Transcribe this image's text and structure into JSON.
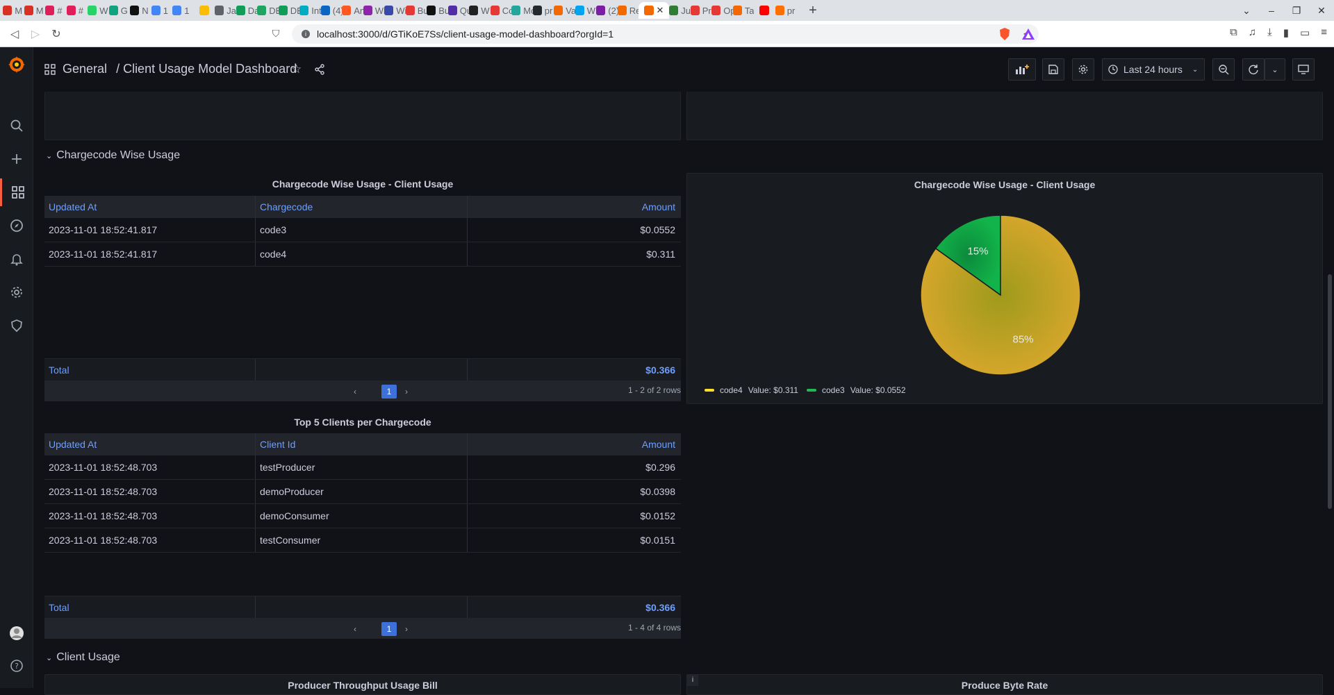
{
  "browser": {
    "tabs": [
      {
        "icon": "gmail-icon",
        "label": "M",
        "color": "#d93025"
      },
      {
        "icon": "gmail-icon",
        "label": "M",
        "color": "#d93025"
      },
      {
        "icon": "slack-icon",
        "label": "#",
        "color": "#e01e5a"
      },
      {
        "icon": "slack-icon",
        "label": "#",
        "color": "#e01e5a"
      },
      {
        "icon": "whatsapp-icon",
        "label": "W",
        "color": "#25d366"
      },
      {
        "icon": "chatgpt-icon",
        "label": "G",
        "color": "#10a37f"
      },
      {
        "icon": "notion-icon",
        "label": "N",
        "color": "#111111"
      },
      {
        "icon": "calendar-icon",
        "label": "1",
        "color": "#4285f4"
      },
      {
        "icon": "calendar-icon",
        "label": "1",
        "color": "#4285f4"
      },
      {
        "icon": "keep-icon",
        "label": "",
        "color": "#fbbc04"
      },
      {
        "icon": "globe-icon",
        "label": "Ja",
        "color": "#5f6368"
      },
      {
        "icon": "sheets-icon",
        "label": "Da",
        "color": "#0f9d58"
      },
      {
        "icon": "drive-icon",
        "label": "DE",
        "color": "#1fa463"
      },
      {
        "icon": "sheets-icon",
        "label": "DE",
        "color": "#0f9d58"
      },
      {
        "icon": "web-icon",
        "label": "Int",
        "color": "#00acc1"
      },
      {
        "icon": "linkedin-icon",
        "label": "(4)",
        "color": "#0a66c2"
      },
      {
        "icon": "aws-icon",
        "label": "An",
        "color": "#ff5722"
      },
      {
        "icon": "web-icon",
        "label": "Wi",
        "color": "#8e24aa"
      },
      {
        "icon": "web-icon",
        "label": "Wi",
        "color": "#3949ab"
      },
      {
        "icon": "web-icon",
        "label": "Bu",
        "color": "#e53935"
      },
      {
        "icon": "web-icon",
        "label": "Bu",
        "color": "#111111"
      },
      {
        "icon": "web-icon",
        "label": "Qu",
        "color": "#512da8"
      },
      {
        "icon": "web-icon",
        "label": "W",
        "color": "#212121"
      },
      {
        "icon": "mic-icon",
        "label": "Cc",
        "color": "#e53935"
      },
      {
        "icon": "web-icon",
        "label": "Mo",
        "color": "#26a69a"
      },
      {
        "icon": "github-icon",
        "label": "pr",
        "color": "#24292e"
      },
      {
        "icon": "grafana-icon",
        "label": "Va",
        "color": "#f46800"
      },
      {
        "icon": "microsoft-icon",
        "label": "W",
        "color": "#00a4ef"
      },
      {
        "icon": "web-icon",
        "label": "(2)",
        "color": "#7b1fa2"
      },
      {
        "icon": "grafana-icon",
        "label": "Re",
        "color": "#f46800"
      },
      {
        "icon": "grafana-icon",
        "label": "",
        "color": "#f46800",
        "active": true
      },
      {
        "icon": "web-icon",
        "label": "Ju",
        "color": "#2e7d32"
      },
      {
        "icon": "mic-icon",
        "label": "Pr",
        "color": "#e53935"
      },
      {
        "icon": "mic-icon",
        "label": "Op",
        "color": "#e53935"
      },
      {
        "icon": "grafana-icon",
        "label": "Ta",
        "color": "#f46800"
      },
      {
        "icon": "youtube-icon",
        "label": "",
        "color": "#ff0000"
      },
      {
        "icon": "web-icon",
        "label": "pr",
        "color": "#ff6f00"
      }
    ],
    "url": "localhost:3000/d/GTiKoE7Ss/client-usage-model-dashboard?orgId=1"
  },
  "dashboard": {
    "folder": "General",
    "title": "/ Client Usage Model Dashboard",
    "time_range": "Last 24 hours"
  },
  "rows": {
    "chargecode": "Chargecode Wise Usage",
    "client": "Client Usage"
  },
  "panel1": {
    "title": "Chargecode Wise Usage - Client Usage",
    "columns": [
      "Updated At",
      "Chargecode",
      "Amount"
    ],
    "rows": [
      [
        "2023-11-01 18:52:41.817",
        "code3",
        "$0.0552"
      ],
      [
        "2023-11-01 18:52:41.817",
        "code4",
        "$0.311"
      ]
    ],
    "total_label": "Total",
    "total_value": "$0.366",
    "page": "1",
    "page_info": "1 - 2 of 2 rows"
  },
  "panel2": {
    "title": "Chargecode Wise Usage - Client Usage",
    "chart_data": {
      "type": "pie",
      "slices": [
        {
          "name": "code4",
          "value": 0.311,
          "label": "85%",
          "color": "#c9a227"
        },
        {
          "name": "code3",
          "value": 0.0552,
          "label": "15%",
          "color": "#0aa54a"
        }
      ],
      "legend": [
        {
          "name": "code4",
          "text": "Value: $0.311",
          "color": "#fade2a"
        },
        {
          "name": "code3",
          "text": "Value: $0.0552",
          "color": "#1fba52"
        }
      ]
    }
  },
  "panel3": {
    "title": "Top 5 Clients per Chargecode",
    "columns": [
      "Updated At",
      "Client Id",
      "Amount"
    ],
    "rows": [
      [
        "2023-11-01 18:52:48.703",
        "testProducer",
        "$0.296"
      ],
      [
        "2023-11-01 18:52:48.703",
        "demoProducer",
        "$0.0398"
      ],
      [
        "2023-11-01 18:52:48.703",
        "demoConsumer",
        "$0.0152"
      ],
      [
        "2023-11-01 18:52:48.703",
        "testConsumer",
        "$0.0151"
      ]
    ],
    "total_label": "Total",
    "total_value": "$0.366",
    "page": "1",
    "page_info": "1 - 4 of 4 rows"
  },
  "panel4": {
    "title": "Producer Throughput Usage Bill"
  },
  "panel5": {
    "title": "Produce Byte Rate",
    "info": "i"
  }
}
